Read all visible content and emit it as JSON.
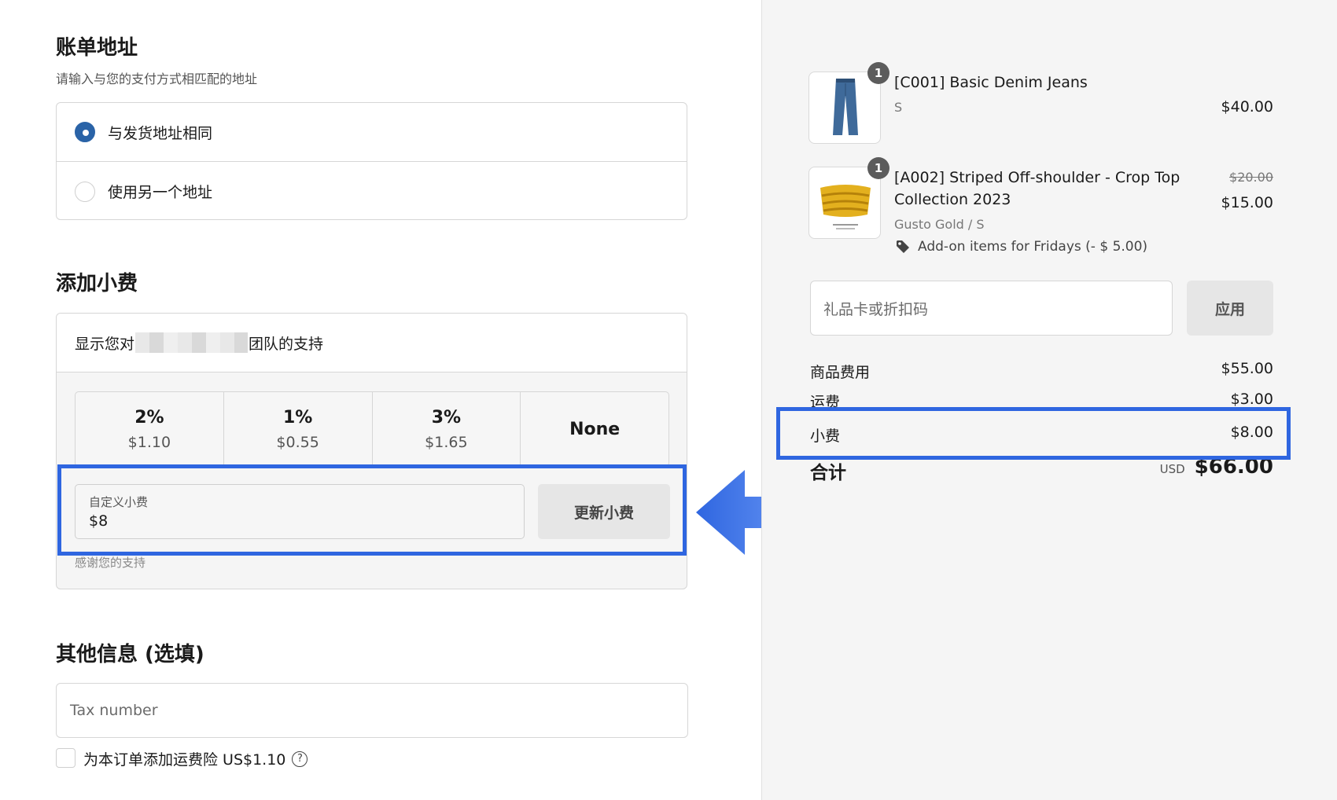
{
  "billing": {
    "title": "账单地址",
    "subtitle": "请输入与您的支付方式相匹配的地址",
    "options": [
      {
        "label": "与发货地址相同",
        "selected": true
      },
      {
        "label": "使用另一个地址",
        "selected": false
      }
    ]
  },
  "tip": {
    "title": "添加小费",
    "support_prefix": "显示您对",
    "support_suffix": "团队的支持",
    "options": [
      {
        "percent": "2%",
        "amount": "$1.10"
      },
      {
        "percent": "1%",
        "amount": "$0.55"
      },
      {
        "percent": "3%",
        "amount": "$1.65"
      },
      {
        "percent": "None",
        "amount": ""
      }
    ],
    "custom_label": "自定义小费",
    "custom_value": "$8",
    "update_button": "更新小费",
    "thanks": "感谢您的支持"
  },
  "extra": {
    "title": "其他信息 (选填)",
    "tax_placeholder": "Tax number",
    "insurance_label": "为本订单添加运费险 US$1.10",
    "help_glyph": "?"
  },
  "cart": {
    "items": [
      {
        "qty": "1",
        "name": "[C001] Basic Denim Jeans",
        "variant": "S",
        "price": "$40.00",
        "icon": "jeans-image"
      },
      {
        "qty": "1",
        "name_line1": "[A002] Striped Off-shoulder - Crop Top",
        "name_line2": "Collection 2023",
        "variant": "Gusto Gold / S",
        "original_price": "$20.00",
        "price": "$15.00",
        "discount": "Add-on items for Fridays (- $ 5.00)",
        "icon": "crop-top-image"
      }
    ],
    "gift_placeholder": "礼品卡或折扣码",
    "apply_button": "应用"
  },
  "summary": {
    "subtotal_label": "商品费用",
    "subtotal_value": "$55.00",
    "shipping_label": "运费",
    "shipping_value": "$3.00",
    "tip_label": "小费",
    "tip_value": "$8.00",
    "total_label": "合计",
    "currency": "USD",
    "total_value": "$66.00"
  },
  "colors": {
    "highlight": "#2f66e0",
    "radio_selected": "#2a63a7"
  }
}
